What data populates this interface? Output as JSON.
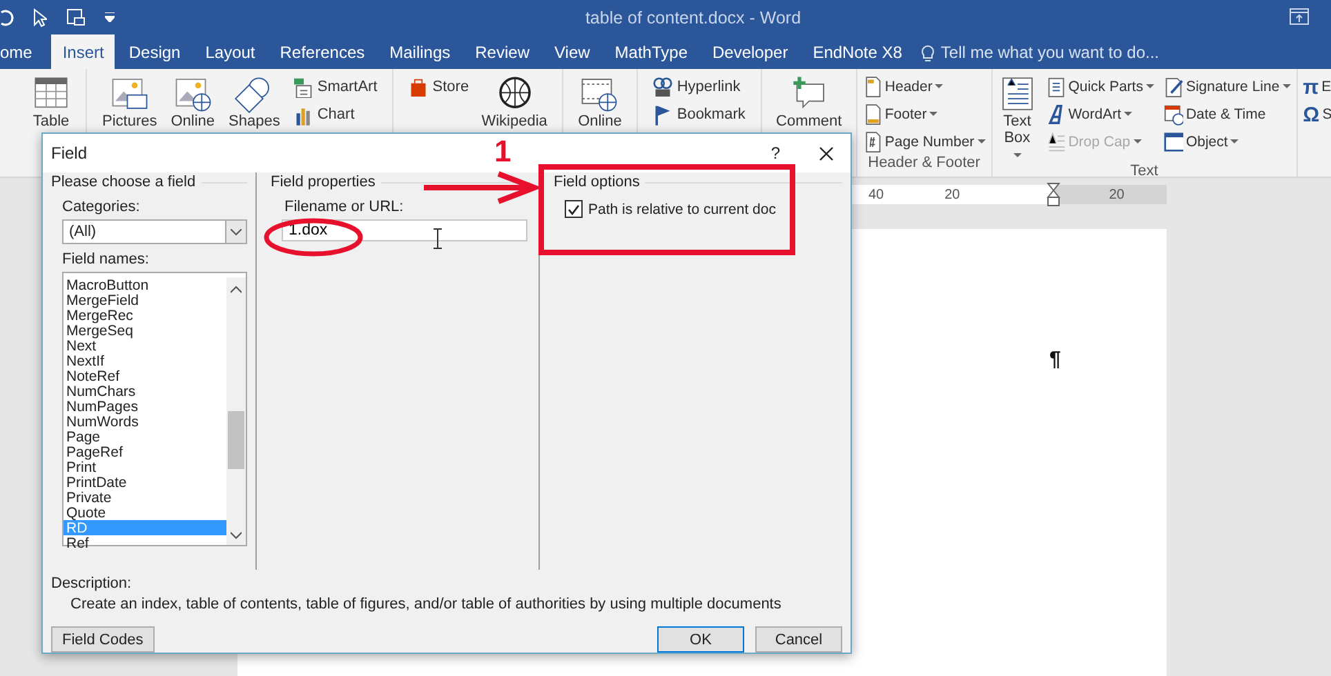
{
  "window": {
    "title": "table of content.docx - Word"
  },
  "tabs": [
    {
      "label": "ome",
      "selected": false
    },
    {
      "label": "Insert",
      "selected": true
    },
    {
      "label": "Design",
      "selected": false
    },
    {
      "label": "Layout",
      "selected": false
    },
    {
      "label": "References",
      "selected": false
    },
    {
      "label": "Mailings",
      "selected": false
    },
    {
      "label": "Review",
      "selected": false
    },
    {
      "label": "View",
      "selected": false
    },
    {
      "label": "MathType",
      "selected": false
    },
    {
      "label": "Developer",
      "selected": false
    },
    {
      "label": "EndNote X8",
      "selected": false
    }
  ],
  "tell_me": "Tell me what you want to do...",
  "ribbon": [
    {
      "items": [
        {
          "kind": "large",
          "label": "Table"
        }
      ]
    },
    {
      "items": [
        {
          "kind": "large",
          "label": "Pictures"
        },
        {
          "kind": "large",
          "label": "Online"
        },
        {
          "kind": "large",
          "label": "Shapes"
        },
        {
          "kind": "stack",
          "items": [
            {
              "label": "SmartArt",
              "menu": false,
              "disabled": false
            },
            {
              "label": "Chart",
              "menu": false,
              "disabled": false
            }
          ]
        }
      ]
    },
    {
      "items": [
        {
          "kind": "stack",
          "items": [
            {
              "label": "Store",
              "menu": false,
              "disabled": false
            }
          ]
        },
        {
          "kind": "large",
          "label": "Wikipedia"
        }
      ]
    },
    {
      "items": [
        {
          "kind": "large",
          "label": "Online"
        }
      ]
    },
    {
      "items": [
        {
          "kind": "stack",
          "items": [
            {
              "label": "Hyperlink",
              "menu": false,
              "disabled": false
            },
            {
              "label": "Bookmark",
              "menu": false,
              "disabled": false
            }
          ]
        }
      ]
    },
    {
      "items": [
        {
          "kind": "large",
          "label": "Comment"
        }
      ]
    },
    {
      "label": "Header & Footer",
      "items": [
        {
          "kind": "stack",
          "items": [
            {
              "label": "Header",
              "menu": true,
              "disabled": false
            },
            {
              "label": "Footer",
              "menu": true,
              "disabled": false
            },
            {
              "label": "Page Number",
              "menu": true,
              "disabled": false
            }
          ]
        }
      ]
    },
    {
      "label": "Text",
      "items": [
        {
          "kind": "large",
          "label": "Text Box",
          "menu": true,
          "disabled": false
        },
        {
          "kind": "stack",
          "items": [
            {
              "label": "Quick Parts",
              "menu": true,
              "disabled": false
            },
            {
              "label": "WordArt",
              "menu": true,
              "disabled": false
            },
            {
              "label": "Drop Cap",
              "menu": true,
              "disabled": true
            }
          ]
        },
        {
          "kind": "stack",
          "items": [
            {
              "label": "Signature Line",
              "menu": true,
              "disabled": false
            },
            {
              "label": "Date & Time",
              "menu": false,
              "disabled": false
            },
            {
              "label": "Object",
              "menu": true,
              "disabled": false
            }
          ]
        }
      ]
    },
    {
      "items": [
        {
          "kind": "symbols",
          "items": [
            {
              "glyph": "π",
              "label": "E"
            },
            {
              "glyph": "Ω",
              "label": "S"
            }
          ]
        }
      ]
    }
  ],
  "ruler": {
    "labels": [
      "40",
      "20",
      "20"
    ]
  },
  "document": {
    "paragraph_mark": "¶"
  },
  "dialog": {
    "title": "Field",
    "help": "?",
    "left": {
      "heading": "Please choose a field",
      "categories_label": "Categories:",
      "category": "(All)",
      "field_names_label": "Field names:",
      "field_names": [
        {
          "label": "MacroButton",
          "selected": false
        },
        {
          "label": "MergeField",
          "selected": false
        },
        {
          "label": "MergeRec",
          "selected": false
        },
        {
          "label": "MergeSeq",
          "selected": false
        },
        {
          "label": "Next",
          "selected": false
        },
        {
          "label": "NextIf",
          "selected": false
        },
        {
          "label": "NoteRef",
          "selected": false
        },
        {
          "label": "NumChars",
          "selected": false
        },
        {
          "label": "NumPages",
          "selected": false
        },
        {
          "label": "NumWords",
          "selected": false
        },
        {
          "label": "Page",
          "selected": false
        },
        {
          "label": "PageRef",
          "selected": false
        },
        {
          "label": "Print",
          "selected": false
        },
        {
          "label": "PrintDate",
          "selected": false
        },
        {
          "label": "Private",
          "selected": false
        },
        {
          "label": "Quote",
          "selected": false
        },
        {
          "label": "RD",
          "selected": true
        },
        {
          "label": "Ref",
          "selected": false
        }
      ]
    },
    "properties": {
      "heading": "Field properties",
      "filename_label": "Filename or URL:",
      "filename": "1.dox"
    },
    "options": {
      "heading": "Field options",
      "items": [
        {
          "label": "Path is relative to current doc",
          "checked": true
        }
      ]
    },
    "description_label": "Description:",
    "description": "Create an index, table of contents, table of figures, and/or table of authorities by using multiple documents",
    "buttons": [
      {
        "label": "Field Codes",
        "kind": "side"
      },
      {
        "label": "OK",
        "kind": "default"
      },
      {
        "label": "Cancel",
        "kind": "plain"
      }
    ]
  },
  "annotation": {
    "number": "1"
  }
}
